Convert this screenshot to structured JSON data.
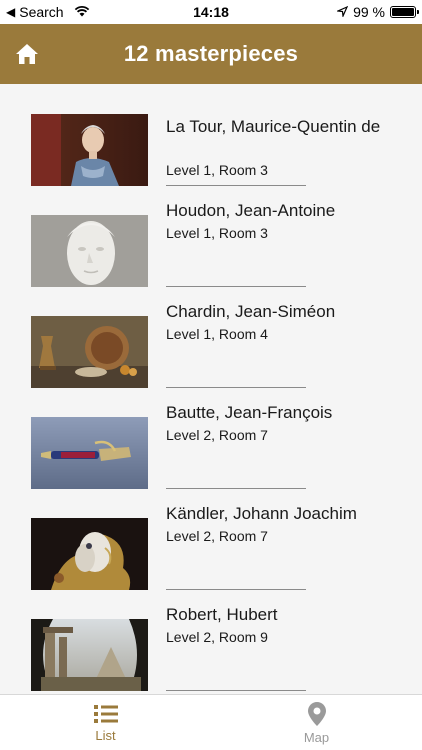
{
  "status_bar": {
    "back_label": "Search",
    "time": "14:18",
    "battery": "99 %",
    "battery_level": 0.99
  },
  "header": {
    "title": "12 masterpieces",
    "color": "#9a7a3b"
  },
  "items": [
    {
      "artist": "La Tour, Maurice-Quentin de",
      "location": "Level 1, Room 3"
    },
    {
      "artist": "Houdon, Jean-Antoine",
      "location": "Level 1, Room 3"
    },
    {
      "artist": "Chardin, Jean-Siméon",
      "location": "Level 1, Room 4"
    },
    {
      "artist": "Bautte, Jean-François",
      "location": "Level 2, Room 7"
    },
    {
      "artist": "Kändler, Johann Joachim",
      "location": "Level 2, Room 7"
    },
    {
      "artist": "Robert, Hubert",
      "location": "Level 2, Room 9"
    }
  ],
  "tabs": {
    "list_label": "List",
    "map_label": "Map",
    "active_color": "#9a7a3b",
    "inactive_color": "#9a9a9a"
  }
}
